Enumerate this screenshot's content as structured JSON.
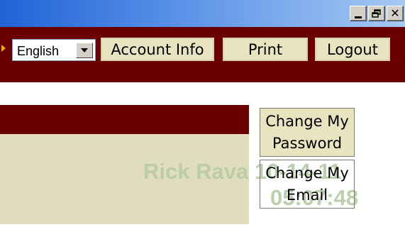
{
  "window": {
    "controls": {
      "minimize": "_",
      "close": "✕"
    }
  },
  "toolbar": {
    "language_select": {
      "value": "English"
    },
    "buttons": {
      "account": "Account Info",
      "print": "Print",
      "logout": "Logout"
    }
  },
  "content": {
    "buttons": {
      "change_password": [
        "Change My",
        "Password"
      ],
      "change_email": [
        "Change My",
        "Email"
      ]
    },
    "watermark": {
      "name": "Rick Rava",
      "date": "10-14-11",
      "time": "05:07:48"
    }
  },
  "colors": {
    "toolbar_bg": "#6b0000",
    "button_bg": "#e8e4c0",
    "panel_bg": "#e0ddbc",
    "watermark": "#b9cca8"
  }
}
